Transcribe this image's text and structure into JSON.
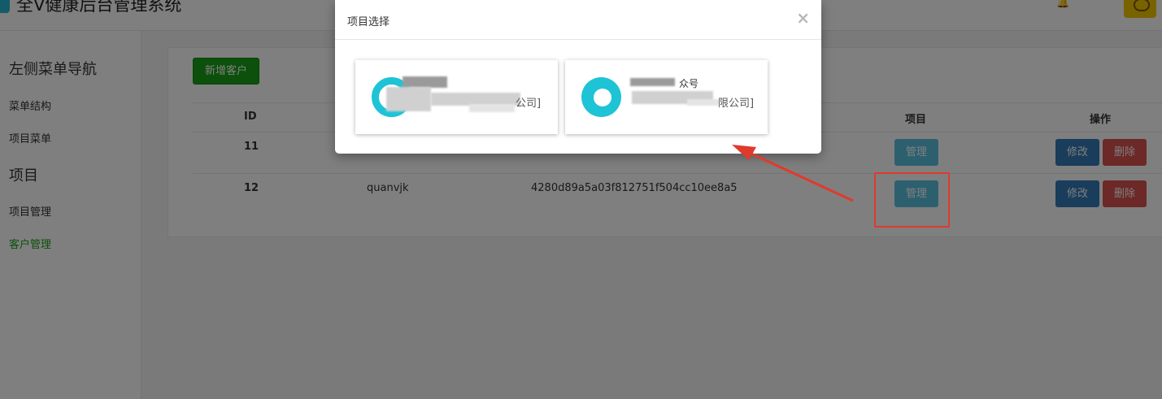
{
  "header": {
    "title": "全V健康后台管理系统"
  },
  "sidebar": {
    "sections": [
      {
        "heading": "左侧菜单导航",
        "items": [
          "菜单结构",
          "项目菜单"
        ]
      },
      {
        "heading": "项目",
        "items": [
          "项目管理",
          "客户管理"
        ]
      }
    ],
    "active_item": "客户管理"
  },
  "main": {
    "new_button": "新增客户",
    "table": {
      "headers": {
        "id": "ID",
        "project": "项目",
        "actions": "操作"
      },
      "rows": [
        {
          "id": "11",
          "name": "",
          "key": "",
          "manage": "管理",
          "edit": "修改",
          "delete": "删除"
        },
        {
          "id": "12",
          "name": "quanvjk",
          "key": "4280d89a5a03f812751f504cc10ee8a5",
          "manage": "管理",
          "edit": "修改",
          "delete": "删除"
        }
      ]
    }
  },
  "modal": {
    "title": "项目选择",
    "close": "×",
    "cards": [
      {
        "visible_text": "公司]"
      },
      {
        "visible_text_top": "众号",
        "visible_text_bottom": "限公司]"
      }
    ]
  },
  "colors": {
    "primary_green": "#18a018",
    "manage_button": "#5bc0de",
    "edit_button": "#337ab7",
    "delete_button": "#d9534f",
    "logo_cyan": "#1ec3d6",
    "annotation_red": "#e03a2c"
  },
  "icons": {
    "bell": "bell-icon",
    "avatar": "user-avatar",
    "close": "close-icon"
  }
}
